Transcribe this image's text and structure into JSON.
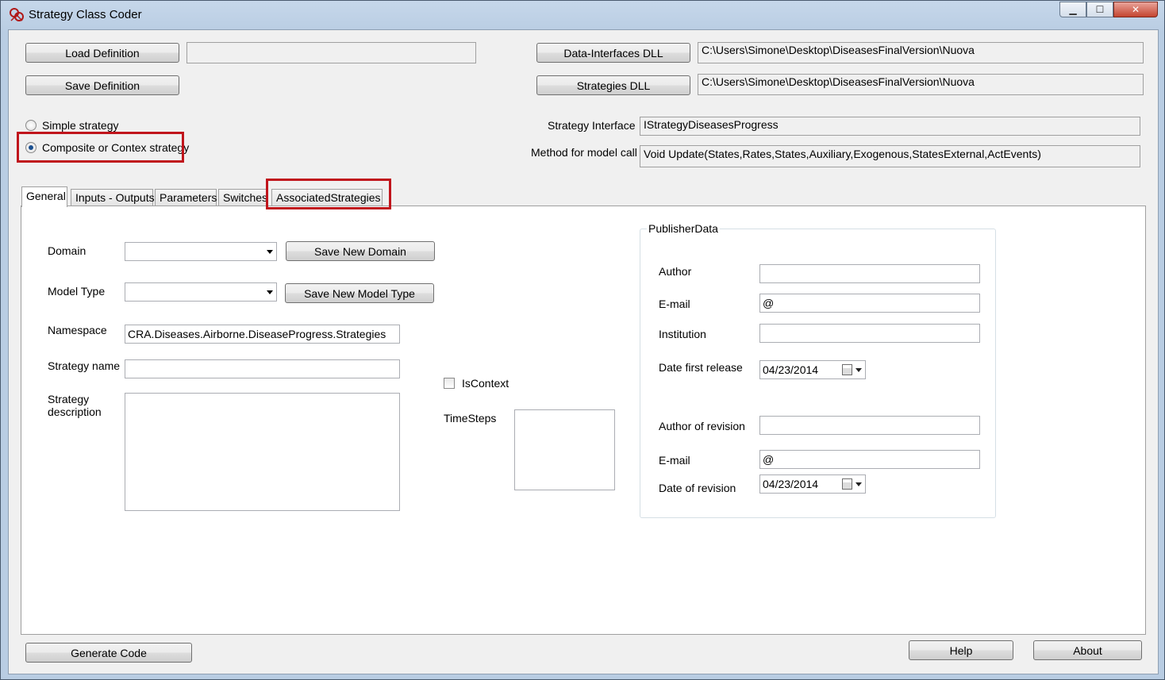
{
  "window": {
    "title": "Strategy Class Coder",
    "controls": {
      "minimize": "▁",
      "maximize": "☐",
      "close": "✕"
    }
  },
  "top": {
    "load_definition_label": "Load Definition",
    "load_definition_value": "",
    "save_definition_label": "Save Definition",
    "data_interfaces_dll_label": "Data-Interfaces DLL",
    "data_interfaces_dll_path": "C:\\Users\\Simone\\Desktop\\DiseasesFinalVersion\\Nuova",
    "strategies_dll_label": "Strategies DLL",
    "strategies_dll_path": "C:\\Users\\Simone\\Desktop\\DiseasesFinalVersion\\Nuova"
  },
  "strategy_type": {
    "simple_label": "Simple strategy",
    "composite_label": "Composite or Contex strategy",
    "selected": "composite"
  },
  "interface": {
    "strategy_interface_label": "Strategy Interface",
    "strategy_interface_value": "IStrategyDiseasesProgress",
    "method_label": "Method for model call",
    "method_value": "Void Update(States,Rates,States,Auxiliary,Exogenous,StatesExternal,ActEvents)"
  },
  "tabs": [
    {
      "label": "General",
      "active": true
    },
    {
      "label": "Inputs - Outputs",
      "active": false
    },
    {
      "label": "Parameters",
      "active": false
    },
    {
      "label": "Switches",
      "active": false
    },
    {
      "label": "AssociatedStrategies",
      "active": false
    }
  ],
  "general": {
    "domain_label": "Domain",
    "domain_value": "",
    "save_new_domain_label": "Save New Domain",
    "model_type_label": "Model Type",
    "model_type_value": "",
    "save_new_model_type_label": "Save New Model Type",
    "namespace_label": "Namespace",
    "namespace_value": "CRA.Diseases.Airborne.DiseaseProgress.Strategies",
    "strategy_name_label": "Strategy name",
    "strategy_name_value": "",
    "strategy_description_label_1": "Strategy",
    "strategy_description_label_2": "description",
    "is_context_label": "IsContext",
    "is_context_checked": false,
    "timesteps_label": "TimeSteps"
  },
  "publisher": {
    "title": "PublisherData",
    "author_label": "Author",
    "author_value": "",
    "email_label": "E-mail",
    "email_value": "@",
    "institution_label": "Institution",
    "institution_value": "",
    "date_first_release_label": "Date first release",
    "date_first_release_value": "04/23/2014",
    "author_revision_label": "Author of revision",
    "author_revision_value": "",
    "email_revision_label": "E-mail",
    "email_revision_value": "@",
    "date_revision_label": "Date of revision",
    "date_revision_value": "04/23/2014"
  },
  "bottom": {
    "generate_code_label": "Generate Code",
    "help_label": "Help",
    "about_label": "About"
  },
  "colors": {
    "highlight_red": "#c0151c",
    "titlebar": "#b9cde3",
    "client_bg": "#f0f0f0"
  }
}
